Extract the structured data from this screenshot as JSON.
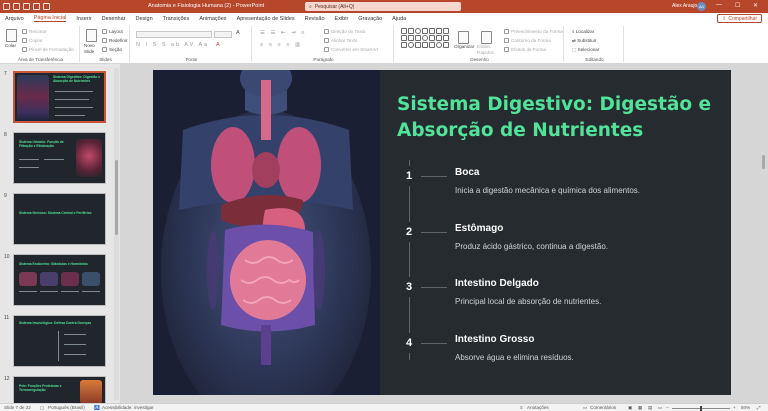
{
  "titlebar": {
    "doc_title": "Anatomia e Fisiologia Humana (2)  -  PowerPoint",
    "search_placeholder": "Pesquisar (Alt+Q)",
    "user_name": "Alex Araujo",
    "user_initials": "AA"
  },
  "menu": {
    "tabs": [
      "Arquivo",
      "Página Inicial",
      "Inserir",
      "Desenhar",
      "Design",
      "Transições",
      "Animações",
      "Apresentação de Slides",
      "Revisão",
      "Exibir",
      "Gravação",
      "Ajuda"
    ],
    "active_index": 1,
    "share_label": "Compartilhar"
  },
  "ribbon": {
    "clipboard": {
      "paste": "Colar",
      "undo": "Recortar",
      "copy": "Copiar",
      "format_painter": "Pincel de Formatação",
      "label": "Área de Transferência"
    },
    "slides": {
      "new_slide": "Novo Slide",
      "layout": "Layout",
      "reset": "Redefinir",
      "section": "Seção",
      "label": "Slides"
    },
    "font": {
      "label": "Fonte"
    },
    "paragraph": {
      "text_direction": "Direção do Texto",
      "align_text": "Alinhar Texto",
      "convert_smartart": "Converter em SmartArt",
      "label": "Parágrafo"
    },
    "drawing": {
      "arrange": "Organizar",
      "quick_styles": "Estilos Rápidos",
      "shape_fill": "Preenchimento da Forma",
      "shape_outline": "Contorno da Forma",
      "shape_effects": "Efeitos da Forma",
      "label": "Desenho"
    },
    "editing": {
      "find": "Localizar",
      "replace": "Substituir",
      "select": "Selecionar",
      "label": "Editando"
    }
  },
  "thumbnails": [
    {
      "num": "7",
      "title": "Sistema Digestivo: Digestão e Absorção de Nutrientes",
      "selected": true
    },
    {
      "num": "8",
      "title": "Sistema Urinário: Função de Filtração e Eliminação",
      "selected": false
    },
    {
      "num": "9",
      "title": "Sistema Nervoso: Sistema Central e Periférico",
      "selected": false
    },
    {
      "num": "10",
      "title": "Sistema Endócrino: Glândulas e Hormônios",
      "selected": false
    },
    {
      "num": "11",
      "title": "Sistema Imunológico: Defesa Contra Doenças",
      "selected": false
    },
    {
      "num": "12",
      "title": "Pele: Funções Protetoras e Termorregulação",
      "selected": false
    }
  ],
  "slide": {
    "title": "Sistema Digestivo: Digestão e Absorção de Nutrientes",
    "items": [
      {
        "num": "1",
        "heading": "Boca",
        "desc": "Inicia a digestão mecânica e química dos alimentos."
      },
      {
        "num": "2",
        "heading": "Estômago",
        "desc": "Produz ácido gástrico, continua a digestão."
      },
      {
        "num": "3",
        "heading": "Intestino Delgado",
        "desc": "Principal local de absorção de nutrientes."
      },
      {
        "num": "4",
        "heading": "Intestino Grosso",
        "desc": "Absorve água e elimina resíduos."
      }
    ],
    "accent_color": "#52e39a",
    "background_color": "#262b2f"
  },
  "status": {
    "slide_counter": "Slide 7 de 22",
    "language": "Português (Brasil)",
    "accessibility": "Acessibilidade: investigar",
    "notes": "Anotações",
    "comments": "Comentários",
    "zoom": "94%"
  },
  "colors": {
    "brand": "#b7472a"
  }
}
